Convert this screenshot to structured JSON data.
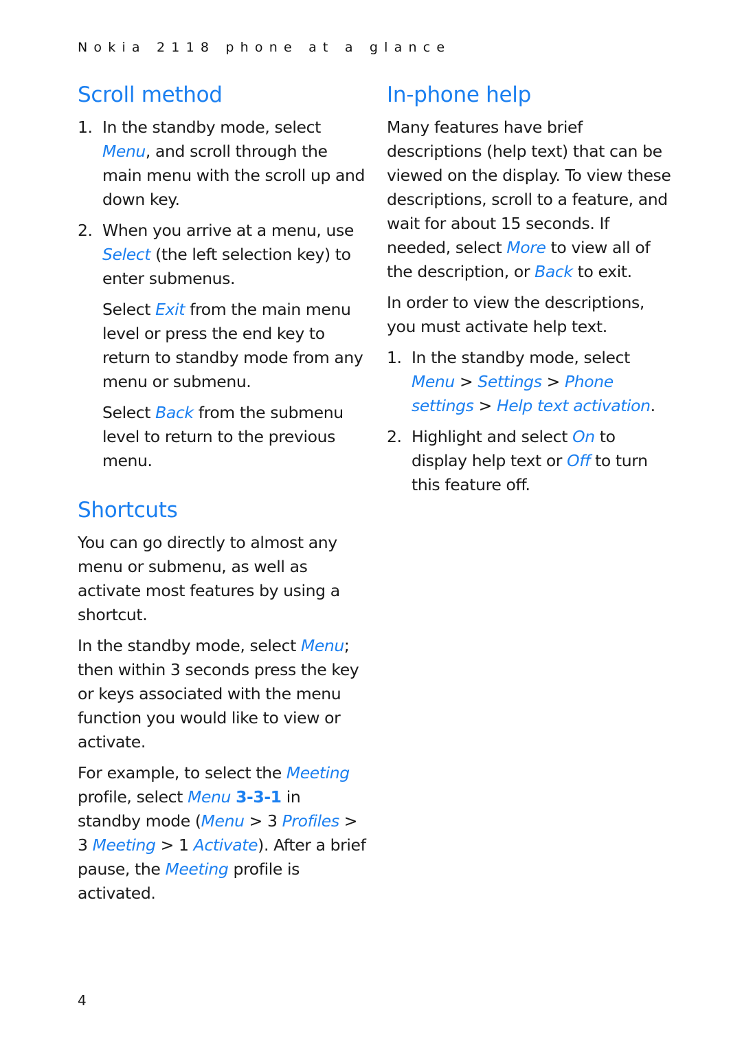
{
  "running_head": "Nokia 2118 phone at a glance",
  "page_number": "4",
  "accent_color": "#1a7ff0",
  "scroll_method": {
    "title": "Scroll method",
    "step1": {
      "num": "1.",
      "t1": "In the standby mode, select ",
      "ui1": "Menu",
      "t2": ", and scroll through the main menu with the scroll up and down key."
    },
    "step2": {
      "num": "2.",
      "t1": "When you arrive at a menu, use ",
      "ui1": "Select",
      "t2": " (the left selection key) to enter submenus."
    },
    "para1": {
      "t1": "Select ",
      "ui1": "Exit",
      "t2": " from the main menu level or press the end key to return to standby mode from any menu or submenu."
    },
    "para2": {
      "t1": "Select ",
      "ui1": "Back",
      "t2": " from the submenu level to return to the previous menu."
    }
  },
  "shortcuts": {
    "title": "Shortcuts",
    "para1": "You can go directly to almost any menu or submenu, as well as activate most features by using a shortcut.",
    "para2": {
      "t1": "In the standby mode, select ",
      "ui1": "Menu",
      "t2": "; then within 3 seconds press the key or keys associated with the menu function you would like to view or activate."
    },
    "para3": {
      "t1": "For example, to select the ",
      "ui1": "Meeting",
      "t2": " profile, select ",
      "ui2": "Menu",
      "key": "3-3-1",
      "t3": " in standby mode (",
      "ui3": "Menu",
      "t4": " > 3 ",
      "ui4": "Profiles",
      "t5": " > 3 ",
      "ui5": "Meeting",
      "t6": " > 1 ",
      "ui6": "Activate",
      "t7": "). After a brief pause, the ",
      "ui7": "Meeting",
      "t8": " profile is activated."
    }
  },
  "in_phone_help": {
    "title": "In-phone help",
    "para1": {
      "t1": "Many features have brief descriptions (help text) that can be viewed on the display. To view these descriptions, scroll to a feature, and wait for about 15 seconds. If needed, select ",
      "ui1": "More",
      "t2": " to view all of the description, or ",
      "ui2": "Back",
      "t3": " to exit."
    },
    "para2": "In order to view the descriptions, you must activate help text.",
    "step1": {
      "num": "1.",
      "t1": "In the standby mode, select ",
      "ui1": "Menu",
      "t2": " > ",
      "ui2": "Settings",
      "t3": " > ",
      "ui3": "Phone settings",
      "t4": " > ",
      "ui4": "Help text activation",
      "t5": "."
    },
    "step2": {
      "num": "2.",
      "t1": "Highlight and select ",
      "ui1": "On",
      "t2": " to display help text or ",
      "ui2": "Off",
      "t3": " to turn this feature off."
    }
  }
}
